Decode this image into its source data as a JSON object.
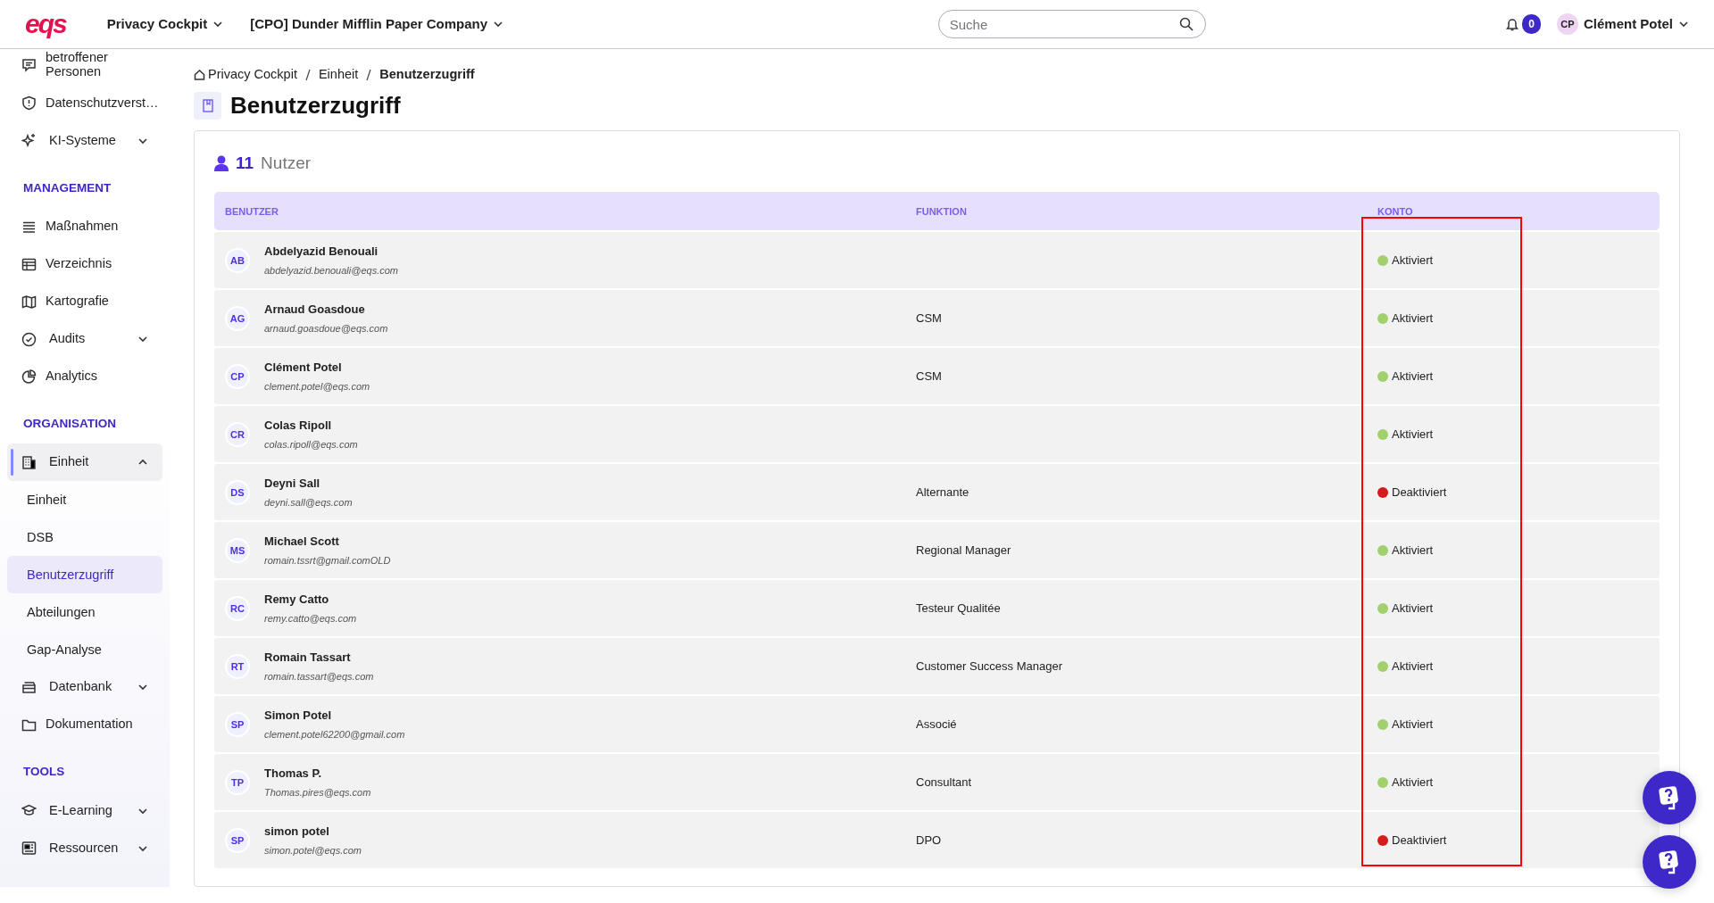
{
  "topbar": {
    "logo": "eqs",
    "menus": [
      {
        "label": "Privacy Cockpit"
      },
      {
        "label": "[CPO] Dunder Mifflin Paper Company"
      }
    ],
    "search": {
      "placeholder": "Suche"
    },
    "notifications": "0",
    "user": {
      "initials": "CP",
      "name": "Clément Potel"
    }
  },
  "sidebar": {
    "items": [
      {
        "kind": "link",
        "label": "betroffener Personen"
      },
      {
        "kind": "link",
        "label": "Datenschutzverst…"
      },
      {
        "kind": "group",
        "label": "KI-Systeme",
        "expanded": false
      },
      {
        "kind": "section",
        "label": "MANAGEMENT"
      },
      {
        "kind": "link",
        "label": "Maßnahmen"
      },
      {
        "kind": "link",
        "label": "Verzeichnis"
      },
      {
        "kind": "link",
        "label": "Kartografie"
      },
      {
        "kind": "group",
        "label": "Audits",
        "expanded": false
      },
      {
        "kind": "link",
        "label": "Analytics"
      },
      {
        "kind": "section",
        "label": "ORGANISATION"
      },
      {
        "kind": "group",
        "label": "Einheit",
        "expanded": true,
        "children": [
          {
            "label": "Einheit",
            "selected": false
          },
          {
            "label": "DSB",
            "selected": false
          },
          {
            "label": "Benutzerzugriff",
            "selected": true
          },
          {
            "label": "Abteilungen",
            "selected": false
          },
          {
            "label": "Gap-Analyse",
            "selected": false
          }
        ]
      },
      {
        "kind": "group",
        "label": "Datenbank",
        "expanded": false
      },
      {
        "kind": "link",
        "label": "Dokumentation"
      },
      {
        "kind": "section",
        "label": "TOOLS"
      },
      {
        "kind": "group",
        "label": "E-Learning",
        "expanded": false
      },
      {
        "kind": "group",
        "label": "Ressourcen",
        "expanded": false
      }
    ]
  },
  "breadcrumb": [
    "Privacy Cockpit",
    "Einheit",
    "Benutzerzugriff"
  ],
  "page_title": "Benutzerzugriff",
  "user_count": {
    "count": "11",
    "label": "Nutzer"
  },
  "table": {
    "columns": [
      {
        "label": "BENUTZER",
        "highlighted": false
      },
      {
        "label": "FUNKTION",
        "highlighted": false
      },
      {
        "label": "KONTO",
        "highlighted": true
      }
    ],
    "rows": [
      {
        "initials": "AB",
        "name": "Abdelyazid Benouali",
        "email": "abdelyazid.benouali@eqs.com",
        "function": "",
        "account": "Aktiviert",
        "active": true
      },
      {
        "initials": "AG",
        "name": "Arnaud Goasdoue",
        "email": "arnaud.goasdoue@eqs.com",
        "function": "CSM",
        "account": "Aktiviert",
        "active": true
      },
      {
        "initials": "CP",
        "name": "Clément Potel",
        "email": "clement.potel@eqs.com",
        "function": "CSM",
        "account": "Aktiviert",
        "active": true
      },
      {
        "initials": "CR",
        "name": "Colas Ripoll",
        "email": "colas.ripoll@eqs.com",
        "function": "",
        "account": "Aktiviert",
        "active": true
      },
      {
        "initials": "DS",
        "name": "Deyni Sall",
        "email": "deyni.sall@eqs.com",
        "function": "Alternante",
        "account": "Deaktiviert",
        "active": false
      },
      {
        "initials": "MS",
        "name": "Michael Scott",
        "email": "romain.tssrt@gmail.comOLD",
        "function": "Regional Manager",
        "account": "Aktiviert",
        "active": true
      },
      {
        "initials": "RC",
        "name": "Remy Catto",
        "email": "remy.catto@eqs.com",
        "function": "Testeur Qualitée",
        "account": "Aktiviert",
        "active": true
      },
      {
        "initials": "RT",
        "name": "Romain Tassart",
        "email": "romain.tassart@eqs.com",
        "function": "Customer Success Manager",
        "account": "Aktiviert",
        "active": true
      },
      {
        "initials": "SP",
        "name": "Simon Potel",
        "email": "clement.potel62200@gmail.com",
        "function": "Associé",
        "account": "Aktiviert",
        "active": true
      },
      {
        "initials": "TP",
        "name": "Thomas P.",
        "email": "Thomas.pires@eqs.com",
        "function": "Consultant",
        "account": "Aktiviert",
        "active": true
      },
      {
        "initials": "SP",
        "name": "simon potel",
        "email": "simon.potel@eqs.com",
        "function": "DPO",
        "account": "Deaktiviert",
        "active": false
      }
    ]
  },
  "help_buttons": [
    {
      "kind": "help"
    },
    {
      "kind": "help"
    }
  ]
}
